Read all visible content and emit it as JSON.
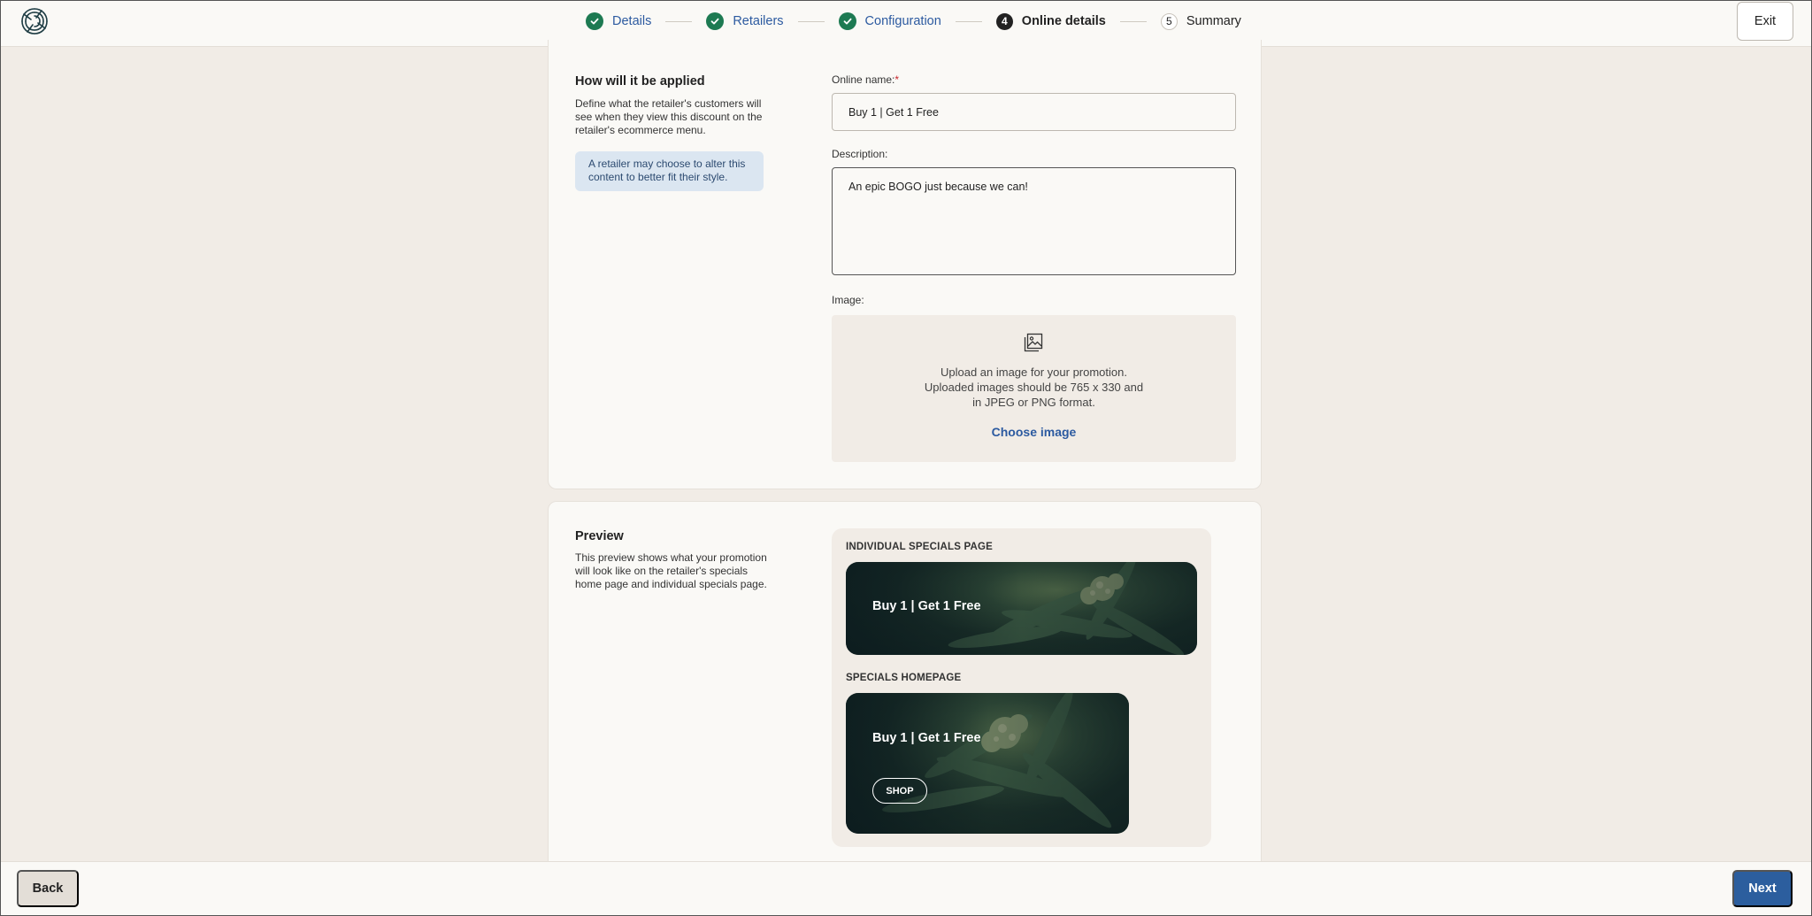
{
  "header": {
    "steps": [
      {
        "number": "",
        "label": "Details",
        "state": "done"
      },
      {
        "number": "",
        "label": "Retailers",
        "state": "done"
      },
      {
        "number": "",
        "label": "Configuration",
        "state": "done"
      },
      {
        "number": "4",
        "label": "Online details",
        "state": "active"
      },
      {
        "number": "5",
        "label": "Summary",
        "state": "todo"
      }
    ],
    "exit_label": "Exit"
  },
  "applied_section": {
    "title": "How will it be applied",
    "description": "Define what the retailer's customers will see when they view this discount on the retailer's ecommerce menu.",
    "info": "A retailer may choose to alter this content to better fit their style.",
    "online_name_label": "Online name:",
    "required_mark": "*",
    "online_name_value": "Buy 1 | Get 1 Free",
    "description_label": "Description:",
    "description_value": "An epic BOGO just because we can!",
    "image_label": "Image:",
    "upload_lines": [
      "Upload an image for your promotion.",
      "Uploaded images should be 765 x 330 and",
      "in JPEG or PNG format."
    ],
    "choose_image_label": "Choose image"
  },
  "preview_section": {
    "title": "Preview",
    "description": "This preview shows what your promotion will look like on the retailer's specials home page and individual specials page.",
    "individual_label": "INDIVIDUAL SPECIALS PAGE",
    "individual_banner_title": "Buy 1 | Get 1 Free",
    "homepage_label": "SPECIALS HOMEPAGE",
    "homepage_banner_title": "Buy 1 | Get 1 Free",
    "shop_label": "SHOP"
  },
  "footer": {
    "back_label": "Back",
    "next_label": "Next"
  },
  "colors": {
    "accent": "#2c5e9e",
    "success": "#1d7a52",
    "background": "#f1ece6",
    "surface": "#faf9f6"
  }
}
